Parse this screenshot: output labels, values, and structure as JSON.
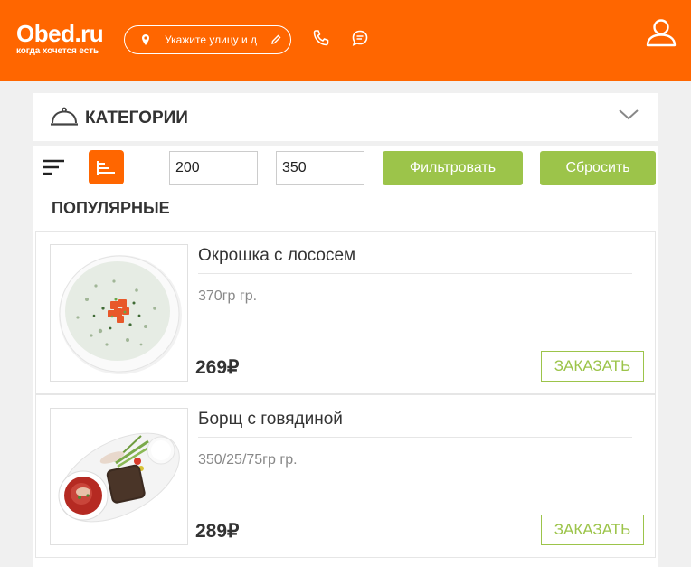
{
  "header": {
    "logo_main": "Obed.ru",
    "logo_sub": "когда хочется есть",
    "address_placeholder": "Укажите улицу и д",
    "colors": {
      "brand": "#ff6600",
      "accent": "#9cc44a"
    }
  },
  "categories": {
    "label": "КАТЕГОРИИ"
  },
  "filter": {
    "price_min": "200",
    "price_max": "350",
    "filter_label": "Фильтровать",
    "reset_label": "Сбросить"
  },
  "section": {
    "title": "ПОПУЛЯРНЫЕ"
  },
  "dishes": [
    {
      "name": "Окрошка с лососем",
      "weight": "370гр гр.",
      "price": "269₽",
      "order_label": "ЗАКАЗАТЬ"
    },
    {
      "name": "Борщ с говядиной",
      "weight": "350/25/75гр гр.",
      "price": "289₽",
      "order_label": "ЗАКАЗАТЬ"
    }
  ]
}
